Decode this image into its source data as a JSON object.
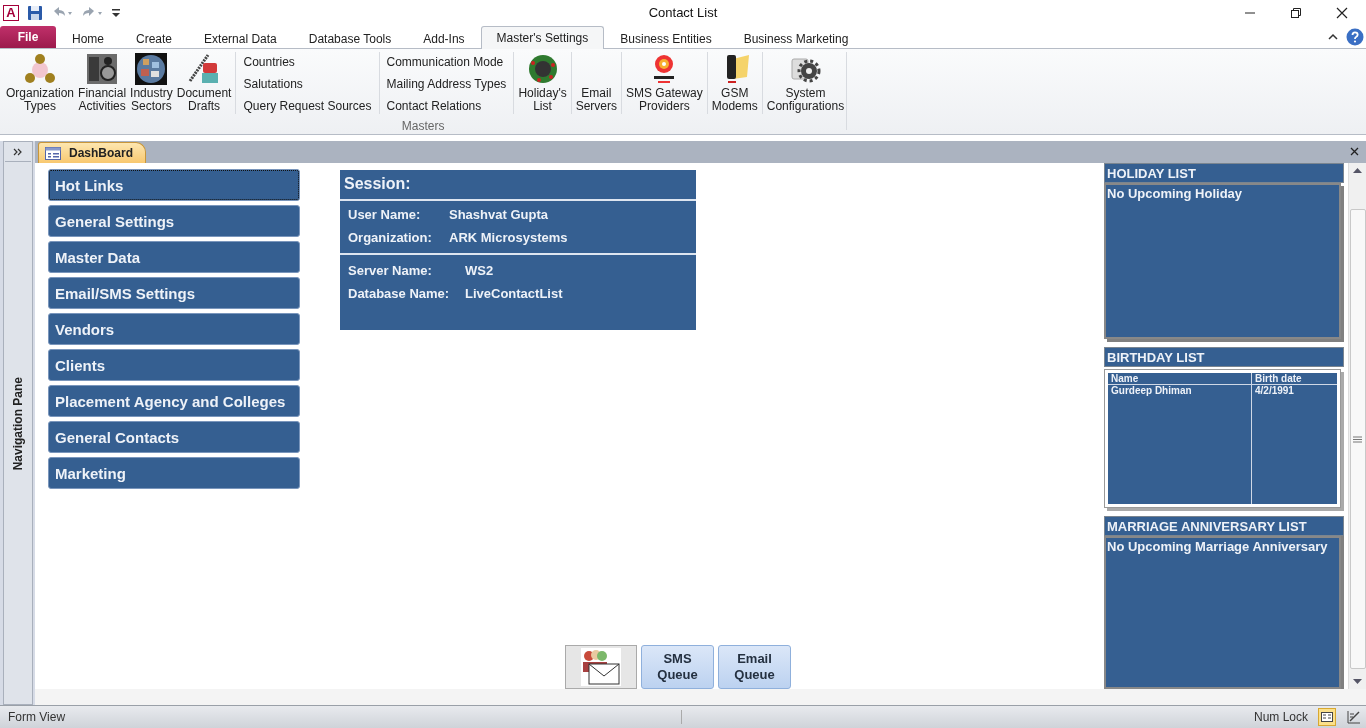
{
  "window": {
    "title": "Contact List",
    "app_logo": "A"
  },
  "ribbon_tabs": [
    {
      "label": "File",
      "kind": "file"
    },
    {
      "label": "Home",
      "kind": "tab",
      "selected": false
    },
    {
      "label": "Create",
      "kind": "tab",
      "selected": false
    },
    {
      "label": "External Data",
      "kind": "tab",
      "selected": false
    },
    {
      "label": "Database Tools",
      "kind": "tab",
      "selected": false
    },
    {
      "label": "Add-Ins",
      "kind": "tab",
      "selected": false
    },
    {
      "label": "Master's Settings",
      "kind": "tab",
      "selected": true
    },
    {
      "label": "Business Entities",
      "kind": "tab",
      "selected": false
    },
    {
      "label": "Business Marketing",
      "kind": "tab",
      "selected": false
    }
  ],
  "ribbon_group": {
    "label": "Masters",
    "items": [
      {
        "kind": "large",
        "lines": [
          "Organization",
          "Types"
        ]
      },
      {
        "kind": "large",
        "lines": [
          "Financial",
          "Activities"
        ]
      },
      {
        "kind": "large",
        "lines": [
          "Industry",
          "Sectors"
        ]
      },
      {
        "kind": "large",
        "lines": [
          "Document",
          "Drafts"
        ],
        "separator": true
      },
      {
        "kind": "column",
        "entries": [
          "Countries",
          "Salutations",
          "Query Request Sources"
        ],
        "separator": true
      },
      {
        "kind": "column",
        "entries": [
          "Communication Mode",
          "Mailing Address Types",
          "Contact Relations"
        ],
        "separator": true
      },
      {
        "kind": "large",
        "lines": [
          "Holiday's",
          "List"
        ],
        "separator": true
      },
      {
        "kind": "large",
        "lines": [
          "Email",
          "Servers"
        ],
        "separator": true
      },
      {
        "kind": "large",
        "lines": [
          "SMS Gateway",
          "Providers"
        ],
        "separator": true
      },
      {
        "kind": "large",
        "lines": [
          "GSM",
          "Modems"
        ],
        "separator": true
      },
      {
        "kind": "large",
        "lines": [
          "System",
          "Configurations"
        ]
      }
    ]
  },
  "navigation_pane": {
    "label": "Navigation Pane"
  },
  "document_tab": {
    "label": "DashBoard"
  },
  "nav_buttons": [
    {
      "label": "Hot Links",
      "selected": true
    },
    {
      "label": "General Settings",
      "selected": false
    },
    {
      "label": "Master Data",
      "selected": false
    },
    {
      "label": "Email/SMS Settings",
      "selected": false
    },
    {
      "label": "Vendors",
      "selected": false
    },
    {
      "label": "Clients",
      "selected": false
    },
    {
      "label": "Placement Agency and Colleges",
      "selected": false
    },
    {
      "label": "General Contacts",
      "selected": false
    },
    {
      "label": "Marketing",
      "selected": false
    }
  ],
  "session": {
    "title": "Session:",
    "sections": [
      [
        {
          "label": "User Name:",
          "value": "Shashvat Gupta"
        },
        {
          "label": "Organization:",
          "value": "ARK Microsystems"
        }
      ],
      [
        {
          "label": "Server Name:",
          "value": "WS2"
        },
        {
          "label": "Database Name:",
          "value": "LiveContactList"
        }
      ]
    ]
  },
  "holiday_list": {
    "title": "HOLIDAY LIST",
    "message": "No Upcoming Holiday"
  },
  "birthday_list": {
    "title": "BIRTHDAY LIST",
    "columns": [
      "Name",
      "Birth date"
    ],
    "rows": [
      [
        "Gurdeep Dhiman",
        "4/2/1991"
      ]
    ]
  },
  "anniversary_list": {
    "title": "MARRIAGE ANNIVERSARY LIST",
    "message": "No Upcoming Marriage Anniversary"
  },
  "queue_buttons": [
    {
      "lines": [
        "SMS",
        "Queue"
      ]
    },
    {
      "lines": [
        "Email",
        "Queue"
      ]
    }
  ],
  "status_bar": {
    "view": "Form View",
    "num_lock": "Num Lock"
  }
}
